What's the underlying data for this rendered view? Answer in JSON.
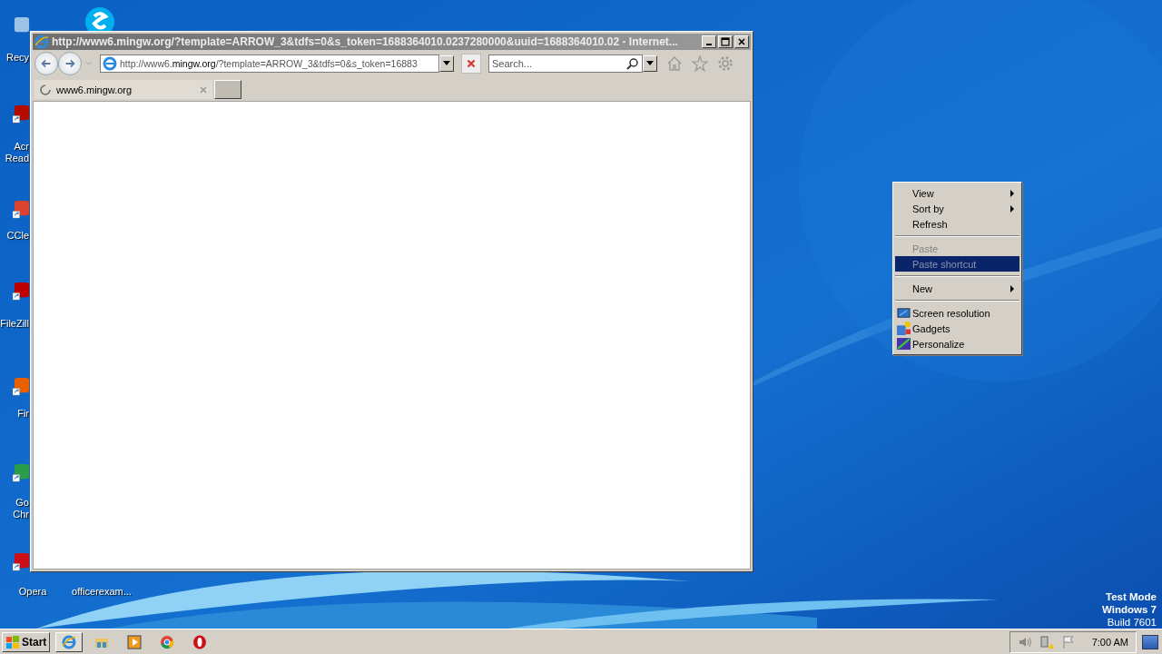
{
  "desktop_icons": [
    {
      "label_lines": [
        "Recy"
      ]
    },
    {
      "label_lines": [
        "Acr",
        "Read"
      ]
    },
    {
      "label_lines": [
        "CCle"
      ]
    },
    {
      "label_lines": [
        "FileZill"
      ]
    },
    {
      "label_lines": [
        "Fir"
      ]
    },
    {
      "label_lines": [
        "Go",
        "Chr"
      ]
    },
    {
      "label_lines": [
        "Opera"
      ]
    },
    {
      "label_lines": [
        "officerexam..."
      ]
    }
  ],
  "window": {
    "title": "http://www6.mingw.org/?template=ARROW_3&tdfs=0&s_token=1688364010.0237280000&uuid=1688364010.02 - Internet...",
    "active": false,
    "address": "http://www6.**mingw.org**/?template=ARROW_3&tdfs=0&s_token=16883",
    "search": {
      "placeholder": "Search..."
    },
    "tabs": [
      {
        "label": "www6.mingw.org",
        "selected": true
      }
    ]
  },
  "context_menu": [
    {
      "kind": "item",
      "label": "View",
      "submenu": true,
      "disabled": false,
      "selected": false
    },
    {
      "kind": "item",
      "label": "Sort by",
      "submenu": true,
      "disabled": false,
      "selected": false
    },
    {
      "kind": "item",
      "label": "Refresh",
      "submenu": false,
      "disabled": false,
      "selected": false
    },
    {
      "kind": "separator"
    },
    {
      "kind": "item",
      "label": "Paste",
      "submenu": false,
      "disabled": true,
      "selected": false
    },
    {
      "kind": "item",
      "label": "Paste shortcut",
      "submenu": false,
      "disabled": true,
      "selected": true
    },
    {
      "kind": "separator"
    },
    {
      "kind": "item",
      "label": "New",
      "submenu": true,
      "disabled": false,
      "selected": false
    },
    {
      "kind": "separator"
    },
    {
      "kind": "resolution",
      "label": "Screen resolution",
      "submenu": false,
      "disabled": false,
      "selected": false
    },
    {
      "kind": "gadgets",
      "label": "Gadgets",
      "submenu": false,
      "disabled": false,
      "selected": false
    },
    {
      "kind": "personalize",
      "label": "Personalize",
      "submenu": false,
      "disabled": false,
      "selected": false
    }
  ],
  "test_mode": [
    "Test Mode",
    "Windows 7",
    "Build 7601"
  ],
  "taskbar": {
    "start": "Start",
    "apps": [
      {
        "kind": "ie",
        "selected": true
      },
      {
        "kind": "explorer",
        "selected": false
      },
      {
        "kind": "media",
        "selected": false
      },
      {
        "kind": "chrome",
        "selected": false
      },
      {
        "kind": "opera",
        "selected": false
      }
    ],
    "clock": "7:00 AM"
  }
}
